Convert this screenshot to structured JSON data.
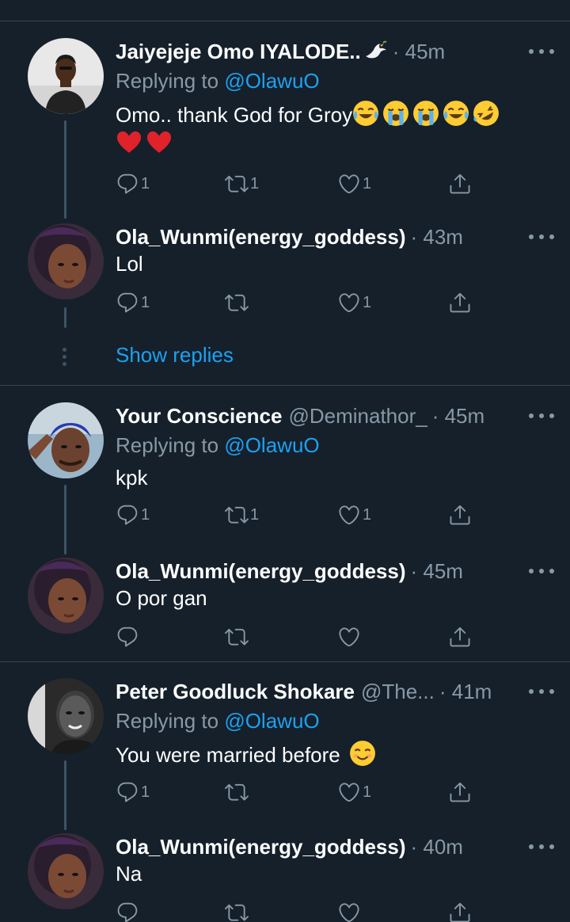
{
  "colors": {
    "background": "#15202b",
    "divider": "#38444d",
    "secondary_text": "#8899a6",
    "link": "#1da1f2",
    "thread_line": "#3d5466"
  },
  "icons": {
    "reply": "speech-bubble-icon",
    "retweet": "retweet-arrows-icon",
    "like": "heart-outline-icon",
    "share": "share-upload-icon",
    "more": "more-horizontal-icon"
  },
  "show_replies_label": "Show replies",
  "tweets": [
    {
      "name": "Jaiyejeje Omo IYALODE..",
      "name_emoji": "dove-with-olive-branch",
      "handle": "",
      "time": "· 45m",
      "replying_prefix": "Replying to",
      "replying_to": "@OlawuO",
      "text": "Omo.. thank God for Groy",
      "emojis": [
        "face-with-tears-of-joy",
        "loudly-crying-face",
        "loudly-crying-face",
        "face-with-tears-of-joy",
        "rolling-on-the-floor-laughing",
        "red-heart",
        "red-heart"
      ],
      "reply_count": "1",
      "retweet_count": "1",
      "like_count": "1"
    },
    {
      "name": "Ola_Wunmi(energy_goddess)",
      "handle": "",
      "time": "· 43m",
      "text": "Lol",
      "reply_count": "1",
      "retweet_count": "",
      "like_count": "1"
    },
    {
      "name": "Your Conscience",
      "handle": "@Deminathor_",
      "time": "· 45m",
      "replying_prefix": "Replying to",
      "replying_to": "@OlawuO",
      "text": "kpk",
      "reply_count": "1",
      "retweet_count": "1",
      "like_count": "1"
    },
    {
      "name": "Ola_Wunmi(energy_goddess)",
      "handle": "",
      "time": "· 45m",
      "text": "O por gan",
      "reply_count": "",
      "retweet_count": "",
      "like_count": ""
    },
    {
      "name": "Peter Goodluck Shokare",
      "handle": "@The...",
      "time": "· 41m",
      "replying_prefix": "Replying to",
      "replying_to": "@OlawuO",
      "text": "You were married before",
      "emojis": [
        "smiling-face-with-smiling-eyes"
      ],
      "reply_count": "1",
      "retweet_count": "",
      "like_count": "1"
    },
    {
      "name": "Ola_Wunmi(energy_goddess)",
      "handle": "",
      "time": "· 40m",
      "text": "Na",
      "reply_count": "",
      "retweet_count": "",
      "like_count": ""
    }
  ]
}
